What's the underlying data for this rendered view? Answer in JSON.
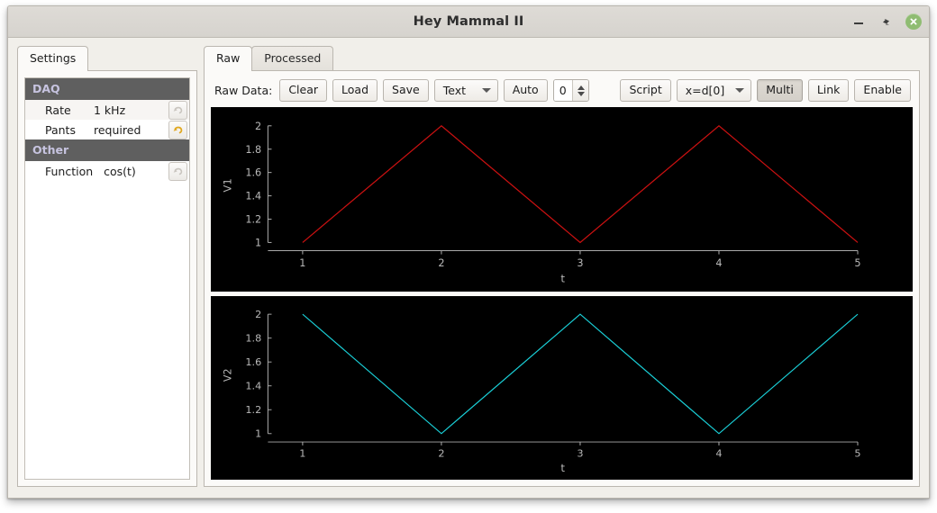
{
  "window": {
    "title": "Hey Mammal II",
    "controls": {
      "minimize": "minimize-icon",
      "maximize": "maximize-icon",
      "close": "close-icon"
    }
  },
  "sidebar": {
    "tab": {
      "label": "Settings"
    },
    "groups": [
      {
        "header": "DAQ",
        "rows": [
          {
            "key": "Rate",
            "value": "1 kHz",
            "revert_active": false
          },
          {
            "key": "Pants",
            "value": "required",
            "revert_active": true
          }
        ]
      },
      {
        "header": "Other",
        "rows": [
          {
            "key": "Function",
            "value": "cos(t)",
            "revert_active": false
          }
        ]
      }
    ]
  },
  "main": {
    "tabs": [
      {
        "label": "Raw",
        "active": true
      },
      {
        "label": "Processed",
        "active": false
      }
    ],
    "toolbar": {
      "label": "Raw Data:",
      "clear_label": "Clear",
      "load_label": "Load",
      "save_label": "Save",
      "format_combo": {
        "value": "Text"
      },
      "auto_label": "Auto",
      "spinner_value": "0",
      "script_label": "Script",
      "expr_combo": {
        "value": "x=d[0]"
      },
      "multi_label": "Multi",
      "link_label": "Link",
      "enable_label": "Enable"
    }
  },
  "colors": {
    "trace1": "#cc1111",
    "trace2": "#1ad0d8",
    "plot_bg": "#000000",
    "axis": "#aaaaaa",
    "group_header_bg": "#5f5f5f",
    "group_header_text": "#c7c4e0",
    "window_bg": "#f1efea",
    "close_button": "#8fbc72"
  },
  "chart_data": [
    {
      "type": "line",
      "title": "",
      "name": "V1",
      "xlabel": "t",
      "ylabel": "V1",
      "xlim": [
        0.75,
        5.25
      ],
      "ylim": [
        0.93,
        2.05
      ],
      "xticks": [
        1,
        2,
        3,
        4,
        5
      ],
      "yticks": [
        1,
        1.2,
        1.4,
        1.6,
        1.8,
        2
      ],
      "ytick_labels": [
        "1",
        "1.2",
        "1.4",
        "1.6",
        "1.8",
        "2"
      ],
      "color": "#cc1111",
      "grid": false,
      "legend": "none",
      "series": [
        {
          "name": "V1",
          "x": [
            1,
            2,
            3,
            4,
            5
          ],
          "y": [
            1,
            2,
            1,
            2,
            1
          ]
        }
      ]
    },
    {
      "type": "line",
      "title": "",
      "name": "V2",
      "xlabel": "t",
      "ylabel": "V2",
      "xlim": [
        0.75,
        5.25
      ],
      "ylim": [
        0.93,
        2.05
      ],
      "xticks": [
        1,
        2,
        3,
        4,
        5
      ],
      "yticks": [
        1,
        1.2,
        1.4,
        1.6,
        1.8,
        2
      ],
      "ytick_labels": [
        "1",
        "1.2",
        "1.4",
        "1.6",
        "1.8",
        "2"
      ],
      "color": "#1ad0d8",
      "grid": false,
      "legend": "none",
      "series": [
        {
          "name": "V2",
          "x": [
            1,
            2,
            3,
            4,
            5
          ],
          "y": [
            2,
            1,
            2,
            1,
            2
          ]
        }
      ]
    }
  ]
}
